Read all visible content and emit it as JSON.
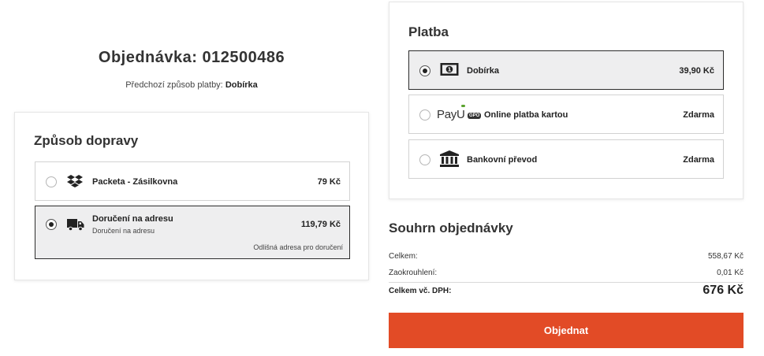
{
  "order": {
    "title": "Objednávka: 012500486",
    "prev_payment_label": "Předchozí způsob platby:",
    "prev_payment_value": "Dobírka"
  },
  "shipping": {
    "title": "Způsob dopravy",
    "options": [
      {
        "label": "Packeta - Zásilkovna",
        "price": "79 Kč",
        "selected": false,
        "icon": "dropbox-box-icon"
      },
      {
        "label": "Doručení na adresu",
        "sublabel": "Doručení na adresu",
        "price": "119,79 Kč",
        "link": "Odlišná adresa pro doručení",
        "selected": true,
        "icon": "truck-icon"
      }
    ]
  },
  "payment": {
    "title": "Platba",
    "options": [
      {
        "label": "Dobírka",
        "price": "39,90 Kč",
        "selected": true,
        "icon": "cash-icon"
      },
      {
        "label": "Online platba kartou",
        "price": "Zdarma",
        "selected": false,
        "icon": "payu-logo",
        "logo_text": "PayU",
        "logo_badge": "GPO"
      },
      {
        "label": "Bankovní převod",
        "price": "Zdarma",
        "selected": false,
        "icon": "bank-icon"
      }
    ]
  },
  "summary": {
    "title": "Souhrn objednávky",
    "rows": [
      {
        "label": "Celkem:",
        "value": "558,67 Kč"
      },
      {
        "label": "Zaokrouhlení:",
        "value": "0,01 Kč"
      },
      {
        "label": "Celkem vč. DPH:",
        "value": "676 Kč"
      }
    ],
    "button_label": "Objednat"
  },
  "colors": {
    "accent": "#e24b26",
    "selected_bg": "#eeeeef",
    "text": "#2b2b2b"
  }
}
